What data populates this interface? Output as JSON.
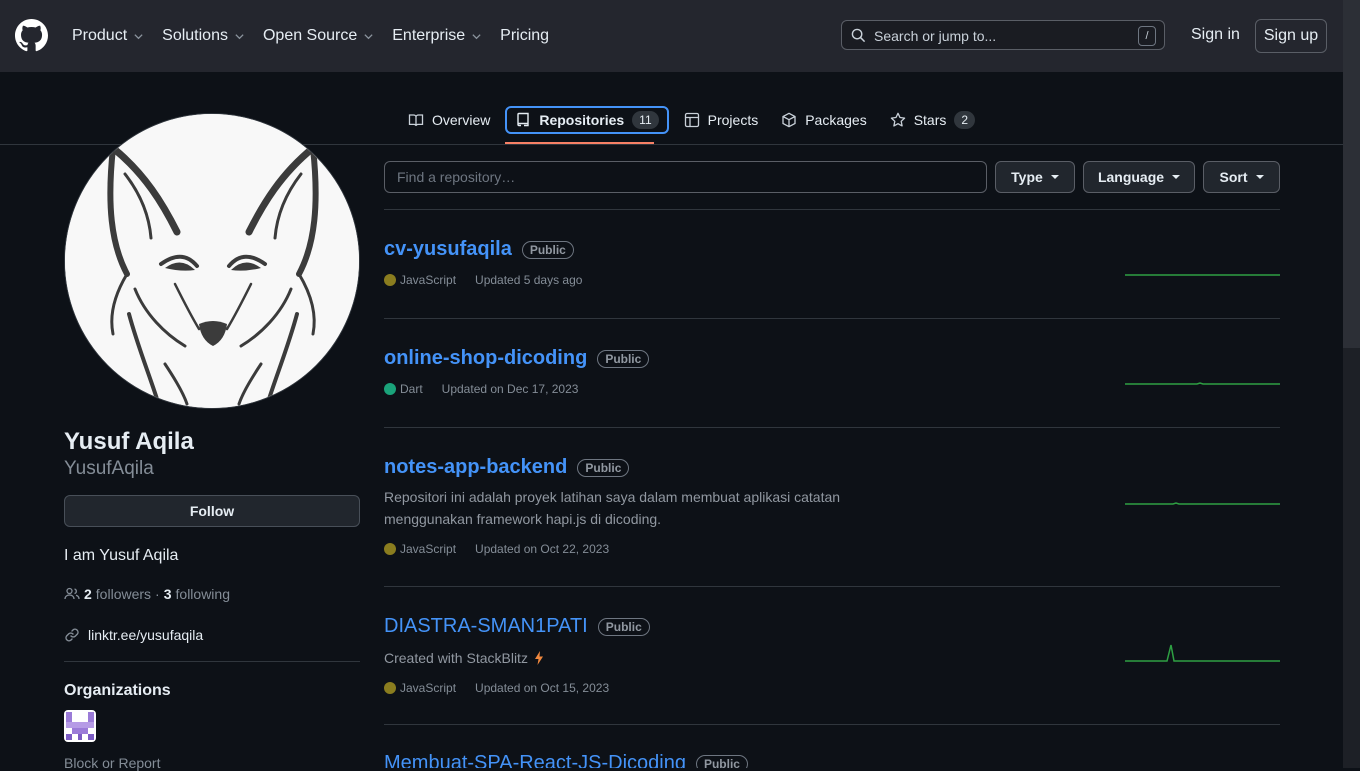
{
  "header": {
    "nav": [
      "Product",
      "Solutions",
      "Open Source",
      "Enterprise",
      "Pricing"
    ],
    "search_placeholder": "Search or jump to...",
    "search_key": "/",
    "sign_in": "Sign in",
    "sign_up": "Sign up"
  },
  "tabs": [
    {
      "label": "Overview",
      "icon": "book-icon"
    },
    {
      "label": "Repositories",
      "icon": "repo-icon",
      "count": "11",
      "active": true
    },
    {
      "label": "Projects",
      "icon": "table-icon"
    },
    {
      "label": "Packages",
      "icon": "package-icon"
    },
    {
      "label": "Stars",
      "icon": "star-icon",
      "count": "2"
    }
  ],
  "profile": {
    "name": "Yusuf Aqila",
    "login": "YusufAqila",
    "follow_label": "Follow",
    "bio": "I am Yusuf Aqila",
    "followers_count": "2",
    "followers_label": "followers",
    "separator": "·",
    "following_count": "3",
    "following_label": "following",
    "link": "linktr.ee/yusufaqila",
    "organizations_title": "Organizations",
    "block_report": "Block or Report"
  },
  "filters": {
    "find_placeholder": "Find a repository…",
    "type": "Type",
    "language": "Language",
    "sort": "Sort"
  },
  "repos": [
    {
      "name": "cv-yusufaqila",
      "visibility": "Public",
      "description": "",
      "language": "JavaScript",
      "language_color": "#8a7d1f",
      "updated": "Updated 5 days ago"
    },
    {
      "name": "online-shop-dicoding",
      "visibility": "Public",
      "description": "",
      "language": "Dart",
      "language_color": "#1aa37a",
      "updated": "Updated on Dec 17, 2023"
    },
    {
      "name": "notes-app-backend",
      "visibility": "Public",
      "description": "Repositori ini adalah proyek latihan saya dalam membuat aplikasi catatan menggunakan framework hapi.js di dicoding.",
      "language": "JavaScript",
      "language_color": "#8a7d1f",
      "updated": "Updated on Oct 22, 2023"
    },
    {
      "name": "DIASTRA-SMAN1PATI",
      "visibility": "Public",
      "description": "Created with StackBlitz",
      "language": "JavaScript",
      "language_color": "#8a7d1f",
      "updated": "Updated on Oct 15, 2023"
    },
    {
      "name": "Membuat-SPA-React-JS-Dicoding",
      "visibility": "Public",
      "description": "",
      "language": "",
      "language_color": "",
      "updated": ""
    }
  ],
  "colors": {
    "accent": "#4493f8",
    "tab_underline": "#f78166",
    "spark": "#2ea043"
  }
}
